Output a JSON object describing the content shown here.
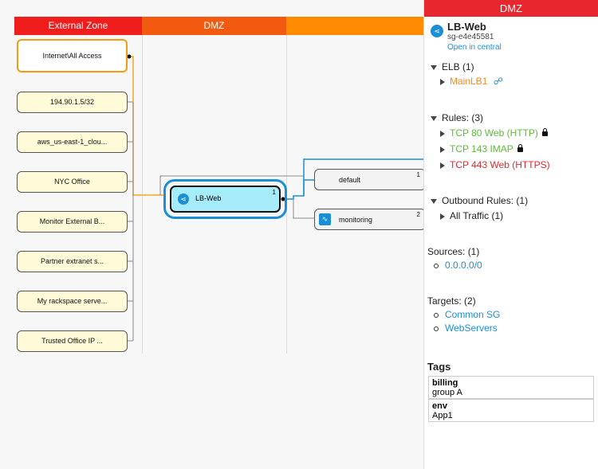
{
  "zones": {
    "external": "External Zone",
    "dmz": "DMZ",
    "third": ""
  },
  "colors": {
    "external": "#f01d1d",
    "dmz": "#f25a10",
    "third": "#ff8c00",
    "accent": "#1b8fd6"
  },
  "sources": [
    "Internet\\All Access",
    "194.90.1.5/32",
    "aws_us-east-1_clou...",
    "NYC Office",
    "Monitor External B...",
    "Partner extranet s...",
    "My rackspace serve...",
    "Trusted Office IP ..."
  ],
  "lb": {
    "label": "LB-Web",
    "count": "1"
  },
  "targets": [
    {
      "label": "default",
      "count": "1"
    },
    {
      "label": "monitoring",
      "count": "2"
    }
  ],
  "panel": {
    "header": "DMZ",
    "title": "LB-Web",
    "sg_id": "sg-e4e45581",
    "open_link": "Open in central",
    "elb_heading": "ELB (1)",
    "elb_item": "MainLB1",
    "rules_heading": "Rules: (3)",
    "rules": [
      {
        "label": "TCP 80 Web (HTTP)",
        "color": "#5fba3c",
        "locked": true
      },
      {
        "label": "TCP 143 IMAP",
        "color": "#5fba3c",
        "locked": true
      },
      {
        "label": "TCP 443 Web (HTTPS)",
        "color": "#e8262d",
        "locked": false
      }
    ],
    "outbound_heading": "Outbound Rules: (1)",
    "outbound_item": "All Traffic (1)",
    "sources_heading": "Sources: (1)",
    "sources_item": "0.0.0.0/0",
    "targets_heading": "Targets: (2)",
    "targets_items": [
      "Common SG",
      "WebServers"
    ],
    "tags_heading": "Tags",
    "tags": [
      {
        "key": "billing",
        "value": "group A"
      },
      {
        "key": "env",
        "value": "App1"
      }
    ]
  }
}
